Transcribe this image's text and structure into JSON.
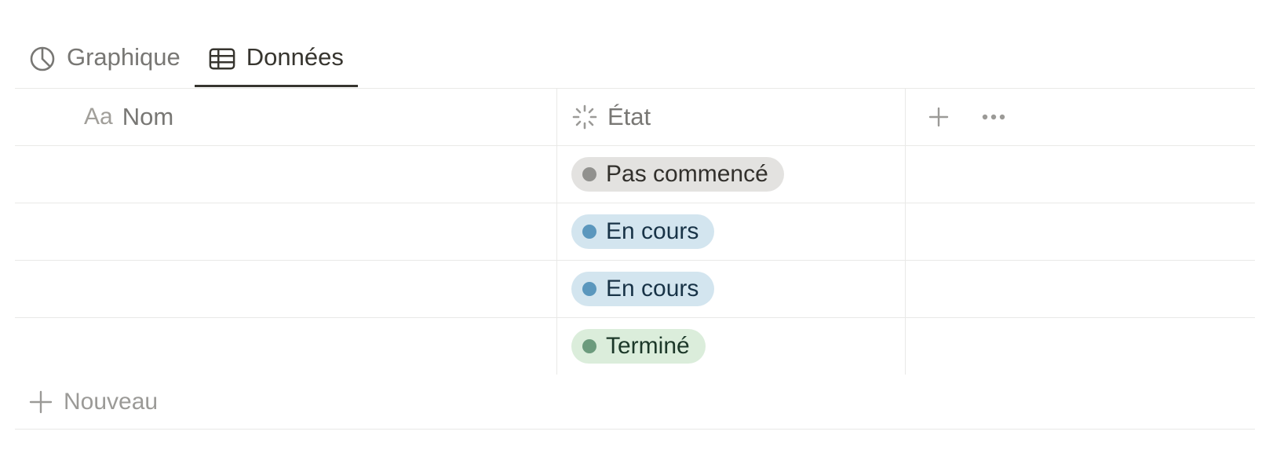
{
  "tabs": [
    {
      "label": "Graphique",
      "icon": "pie-chart-icon",
      "active": false
    },
    {
      "label": "Données",
      "icon": "table-icon",
      "active": true
    }
  ],
  "table": {
    "columns": {
      "name": {
        "prefix": "Aa",
        "label": "Nom"
      },
      "state": {
        "label": "État",
        "icon": "status-spinner-icon"
      }
    },
    "rows": [
      {
        "name": "",
        "state": "Pas commencé",
        "state_color": "#e3e2e0",
        "dot_color": "#91918e",
        "text_color": "#32302c"
      },
      {
        "name": "",
        "state": "En cours",
        "state_color": "#d3e5ef",
        "dot_color": "#5b97bd",
        "text_color": "#183347"
      },
      {
        "name": "",
        "state": "En cours",
        "state_color": "#d3e5ef",
        "dot_color": "#5b97bd",
        "text_color": "#183347"
      },
      {
        "name": "",
        "state": "Terminé",
        "state_color": "#dbeddb",
        "dot_color": "#6c9b7d",
        "text_color": "#1c3829"
      }
    ],
    "new_label": "Nouveau"
  }
}
